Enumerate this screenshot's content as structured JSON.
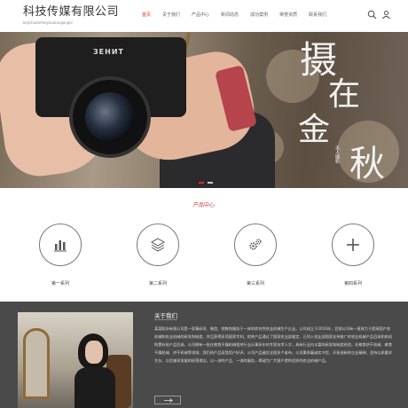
{
  "header": {
    "logo_title": "科技传媒有限公司",
    "logo_subtitle": "kejichuanmeiyouxiangongsi",
    "nav": [
      "首页",
      "关于我们",
      "产品中心",
      "新闻动态",
      "成功案例",
      "荣誉资质",
      "联系我们"
    ],
    "active_nav": 0,
    "icons": [
      "search-icon",
      "user-icon"
    ]
  },
  "banner": {
    "line1": "摄",
    "line2": "在",
    "line3": "金",
    "line4": "秋",
    "side_text": "天人摄影",
    "camera_brand": "ЗЕНИТ"
  },
  "products": {
    "title": "产品中心",
    "items": [
      {
        "label": "第一系列",
        "icon": "bar-chart-icon"
      },
      {
        "label": "第二系列",
        "icon": "layers-icon"
      },
      {
        "label": "第三系列",
        "icon": "gears-icon"
      },
      {
        "label": "第四系列",
        "icon": "plus-icon"
      }
    ]
  },
  "about": {
    "title": "关于我们",
    "text": "某某股份有限公司是一家集研发、制造、销售和服务于一体的综合性农业机械生产企业。公司成立于2016年，目前公司有一直致力于提高国产农机械和农业机械的研发和制造，并且获得多项国家专利。相关产品通过了国家农业部鉴定，已列入农业部国家支持推广的农业机械产品目录和农机购置补贴产品目录。公司拥有一批在粮食干燥机械相关行业从事多年的专家技术人才，具有行业内丰富的研发和制造经验。在粮食烘干机械、粮食干燥机械、烘干机械等领域，我们的产品深受用户好评，公司产品遍及全国多个省市。公司秉承着诚实守信、开拓创新的企业精神，坚持以质量求生存、以信誉求发展的经营理念，以一流的产品、一流的服务，竭诚为广大客户提供优质的农业机械产品。",
    "more_icon": "arrow-right-icon"
  },
  "colors": {
    "accent": "#d92e2e",
    "about_bg": "#4a4a4a"
  }
}
